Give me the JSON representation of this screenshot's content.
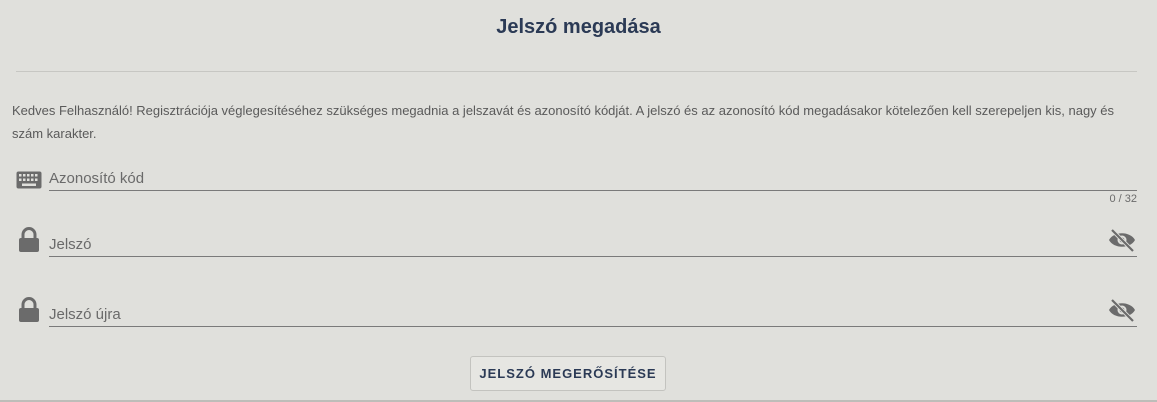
{
  "dialog": {
    "title": "Jelszó megadása",
    "intro": "Kedves Felhasználó! Regisztrációja véglegesítéséhez szükséges megadnia a jelszavát és azonosító kódját. A jelszó és az azonosító kód megadásakor kötelezően kell szerepeljen kis, nagy és szám karakter."
  },
  "fields": {
    "code": {
      "placeholder": "Azonosító kód",
      "counter": "0 / 32",
      "icon": "keyboard-icon"
    },
    "password": {
      "placeholder": "Jelszó",
      "icon": "lock-icon",
      "toggle_icon": "eye-off-icon"
    },
    "password_repeat": {
      "placeholder": "Jelszó újra",
      "icon": "lock-icon",
      "toggle_icon": "eye-off-icon"
    }
  },
  "actions": {
    "confirm_label": "JELSZÓ MEGERŐSÍTÉSE"
  },
  "colors": {
    "title": "#2b3a55",
    "background": "#e0e0dc",
    "icon": "#6b6b6b"
  }
}
